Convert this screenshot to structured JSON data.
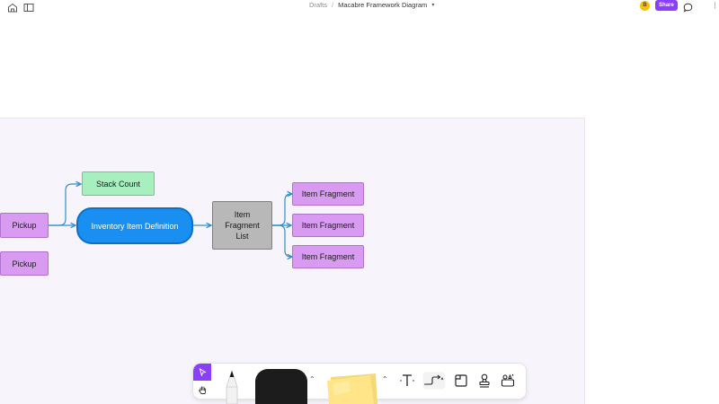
{
  "topbar": {
    "breadcrumb_parent": "Drafts",
    "breadcrumb_separator": "/",
    "file_title": "Macabre Framework Diagram",
    "user_initial": "B",
    "share_label": "Share",
    "icons": [
      "home-icon",
      "sidebar-icon",
      "chevron-down-icon",
      "comment-icon"
    ]
  },
  "diagram": {
    "nodes": {
      "pickup_1": "Pickup",
      "pickup_2": "Pickup",
      "stack_count": "Stack Count",
      "inventory_item_definition": "Inventory Item Definition",
      "item_fragment_list_1": "Item",
      "item_fragment_list_2": "Fragment",
      "item_fragment_list_3": "List",
      "item_fragment_1": "Item Fragment",
      "item_fragment_2": "Item Fragment",
      "item_fragment_3": "Item Fragment"
    },
    "colors": {
      "section_bg": "#f7f4fb",
      "purple_node": "#d99bf2",
      "green_node": "#a8efbf",
      "blue_node": "#1a8ff2",
      "gray_node": "#b8b8b8",
      "connector": "#2f8fcf"
    }
  },
  "toolbar": {
    "tools": [
      "select-tool",
      "hand-tool",
      "pen-tool",
      "shape-tool",
      "sticky-note-tool",
      "text-tool",
      "connector-tool",
      "section-tool",
      "stamp-tool",
      "widgets-tool"
    ],
    "accent": "#8a3ffc"
  }
}
